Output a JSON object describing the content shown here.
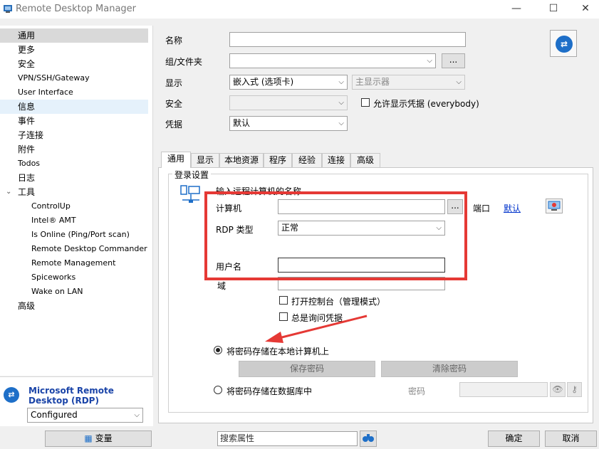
{
  "window": {
    "title": "Remote Desktop Manager",
    "controls": {
      "minimize": "—",
      "maximize": "☐",
      "close": "✕"
    }
  },
  "sidebar": {
    "items": [
      {
        "label": "通用"
      },
      {
        "label": "更多"
      },
      {
        "label": "安全"
      },
      {
        "label": "VPN/SSH/Gateway"
      },
      {
        "label": "User Interface"
      },
      {
        "label": "信息"
      },
      {
        "label": "事件"
      },
      {
        "label": "子连接"
      },
      {
        "label": "附件"
      },
      {
        "label": "Todos"
      },
      {
        "label": "日志"
      },
      {
        "label": "工具"
      },
      {
        "label": "ControlUp"
      },
      {
        "label": "Intel® AMT"
      },
      {
        "label": "Is Online (Ping/Port scan)"
      },
      {
        "label": "Remote Desktop Commander"
      },
      {
        "label": "Remote Management"
      },
      {
        "label": "Spiceworks"
      },
      {
        "label": "Wake on LAN"
      },
      {
        "label": "高级"
      }
    ]
  },
  "entry_panel": {
    "type_title": "Microsoft Remote Desktop (RDP)",
    "status": "Configured"
  },
  "form": {
    "name_label": "名称",
    "name_value": "",
    "group_label": "组/文件夹",
    "group_value": "",
    "browse_label": "...",
    "display_label": "显示",
    "display_value": "嵌入式 (选项卡)",
    "monitor_value": "主显示器",
    "security_label": "安全",
    "security_value": "",
    "allow_show_creds_label": "允许显示凭据 (everybody)",
    "credentials_label": "凭据",
    "credentials_value": "默认"
  },
  "tabs": [
    {
      "label": "通用"
    },
    {
      "label": "显示"
    },
    {
      "label": "本地资源"
    },
    {
      "label": "程序"
    },
    {
      "label": "经验"
    },
    {
      "label": "连接"
    },
    {
      "label": "高级"
    }
  ],
  "login": {
    "group_title": "登录设置",
    "remote_name_label": "输入远程计算机的名称",
    "computer_label": "计算机",
    "computer_value": "",
    "browse_label": "...",
    "port_label": "端口",
    "port_link": "默认",
    "rdp_type_label": "RDP 类型",
    "rdp_type_value": "正常",
    "username_label": "用户名",
    "username_value": "",
    "domain_label": "域",
    "console_label": "打开控制台（管理模式）",
    "always_ask_label": "总是询问凭据",
    "store_local_label": "将密码存储在本地计算机上",
    "save_password_label": "保存密码",
    "clear_password_label": "清除密码",
    "store_db_label": "将密码存储在数据库中",
    "password_label": "密码"
  },
  "footer": {
    "variables_label": "变量",
    "search_placeholder": "搜索属性",
    "ok_label": "确定",
    "cancel_label": "取消"
  }
}
